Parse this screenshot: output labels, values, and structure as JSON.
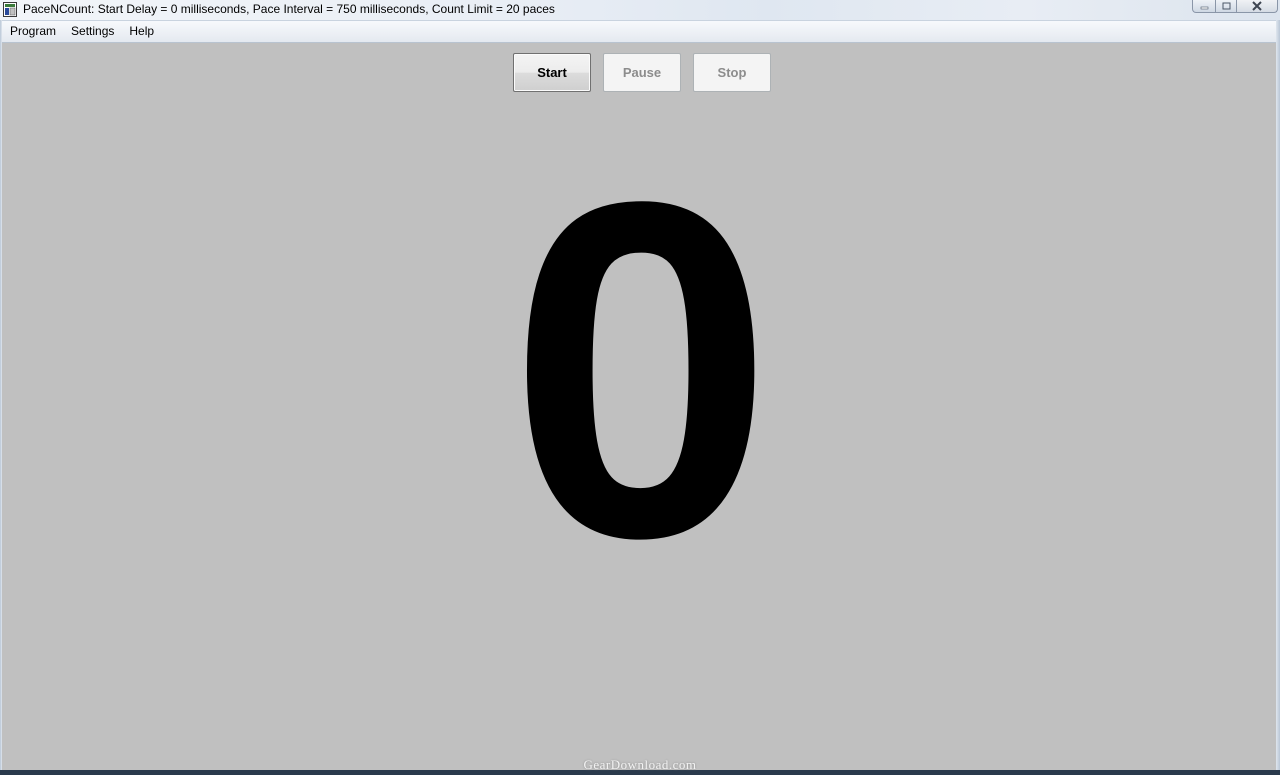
{
  "window": {
    "title": "PaceNCount: Start Delay = 0 milliseconds, Pace Interval = 750 milliseconds, Count Limit = 20 paces"
  },
  "menu": {
    "items": [
      {
        "label": "Program"
      },
      {
        "label": "Settings"
      },
      {
        "label": "Help"
      }
    ]
  },
  "controls": {
    "start_label": "Start",
    "pause_label": "Pause",
    "stop_label": "Stop",
    "pause_enabled": false,
    "stop_enabled": false
  },
  "counter": {
    "value": "0"
  },
  "watermark": {
    "text": "GearDownload.com"
  },
  "colors": {
    "background": "#c0c0c0",
    "counter_text": "#000000",
    "disabled_text": "#8c8c8c"
  }
}
